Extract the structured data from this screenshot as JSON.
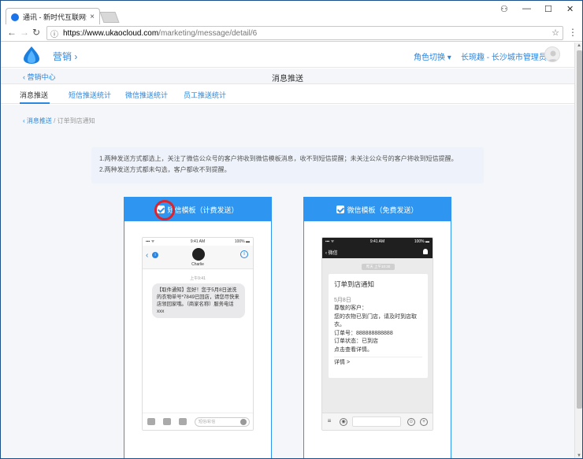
{
  "browser": {
    "tab_title": "通讯 - 新时代互联网洗涤",
    "tab_close": "×",
    "url_host": "https://www.ukaocloud.com",
    "url_path": "/marketing/message/detail/6",
    "win_controls": [
      "⚇",
      "—",
      "☐",
      "✕"
    ]
  },
  "header": {
    "app_name": "营销",
    "role_switch": "角色切换 ▾",
    "user": "长琬趣 - 长沙城市管理员 ▾"
  },
  "subheader": {
    "back": "‹ 营销中心",
    "title": "消息推送"
  },
  "tabs": [
    "消息推送",
    "短信推送统计",
    "微信推送统计",
    "员工推送统计"
  ],
  "breadcrumb": {
    "parent": "‹ 消息推送",
    "sep": "/",
    "current": "订单到店通知"
  },
  "notice": {
    "line1": "1.两种发送方式都选上，关注了微信公众号的客户将收到微信模板消息，收不到短信提醒；未关注公众号的客户将收到短信提醒。",
    "line2": "2.两种发送方式都未勾选，客户都收不到提醒。"
  },
  "sms_card": {
    "header": "短信模板（计费发送）",
    "status_left": "▪▪▪ ᯤ",
    "status_time": "9:41 AM",
    "status_right": "100% ▬",
    "contact": "Charlie",
    "time": "上午9:41",
    "message": "【取件通知】您好！您于5月8日送洗的衣物单号*7849已回店，请您尽快来店领回家哦。（商家名称）服务电话xxx",
    "input_placeholder": "短信/彩信",
    "back_glyph": "‹",
    "badge": "i",
    "info_glyph": "i"
  },
  "wechat_card": {
    "header": "微信模板（免费发送）",
    "status_left": "▪▪▪ ᯤ",
    "status_time": "9:41 AM",
    "status_right": "100% ▬",
    "nav_back": "‹ 微信",
    "time": "昨天 上午10:30",
    "title": "订单到店通知",
    "date": "5月8日",
    "greeting": "尊敬的客户：",
    "body": "您的衣物已到门店，请及时到店取衣。",
    "order_no": "订单号：888888888888",
    "status": "订单状态：已到店",
    "hint": "点击查看详情。",
    "detail": "详情 >",
    "bar_left": "≡",
    "bar_voice": "◉",
    "bar_emoji": "☺",
    "bar_plus": "+"
  },
  "colors": {
    "accent": "#2e96f0",
    "link": "#2a86e0",
    "highlight": "#e0232a"
  }
}
